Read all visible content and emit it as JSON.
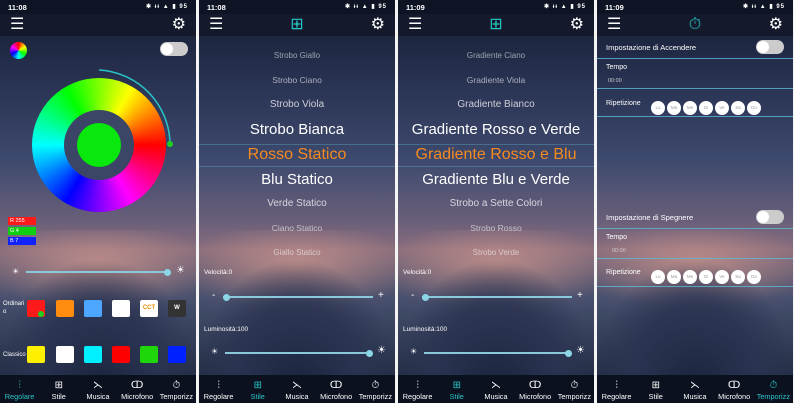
{
  "status": {
    "times": [
      "11:08",
      "11:08",
      "11:09",
      "11:09"
    ],
    "right": "✱ ᵻᵻ ▲ ▮ 95"
  },
  "tabs": [
    "Regolare",
    "Stile",
    "Musica",
    "Microfono",
    "Temporizz"
  ],
  "screen1": {
    "rgb": {
      "r": "R  255",
      "g": "G  4",
      "b": "B  7"
    },
    "row1_label": "Ordinari o",
    "cct": "CCT",
    "w": "W",
    "row2_label": "Classico",
    "colors": {
      "accent": "#27c7c7",
      "ordinari": [
        "#ff1a1a",
        "#ff8c0f",
        "#4da6ff",
        "#ffffff"
      ],
      "classico": [
        "#ffef00",
        "#ffffff",
        "#00f0ff",
        "#ff0000",
        "#1fd60a",
        "#0021ff"
      ]
    }
  },
  "screen2": {
    "items": [
      "Strobo Giallo",
      "Strobo Ciano",
      "Strobo Viola",
      "Strobo Bianca",
      "Rosso Statico",
      "Blu Statico",
      "Verde Statico",
      "Ciano Statico",
      "Giallo Statico"
    ],
    "selected": 4,
    "speed_label": "Velocità:0",
    "brightness_label": "Luminosità:100",
    "minus": "-",
    "plus": "+"
  },
  "screen3": {
    "items": [
      "Gradiente Ciano",
      "Gradiente Viola",
      "Gradiente Bianco",
      "Gradiente Rosso e Verde",
      "Gradiente Rosso e Blu",
      "Gradiente Blu e Verde",
      "Strobo a Sette Colori",
      "Strobo Rosso",
      "Strobo Verde"
    ],
    "selected": 4,
    "speed_label": "Velocità:0",
    "brightness_label": "Luminosità:100",
    "minus": "-",
    "plus": "+"
  },
  "screen4": {
    "on_label": "Impostazione di Accendere",
    "off_label": "Impostazione di Spegnere",
    "time_label": "Tempo",
    "time_value": "00:00",
    "repeat_label": "Ripetizione",
    "days": [
      "Lu",
      "Ma",
      "Me",
      "Gi",
      "Ve",
      "Sa",
      "Do"
    ]
  }
}
